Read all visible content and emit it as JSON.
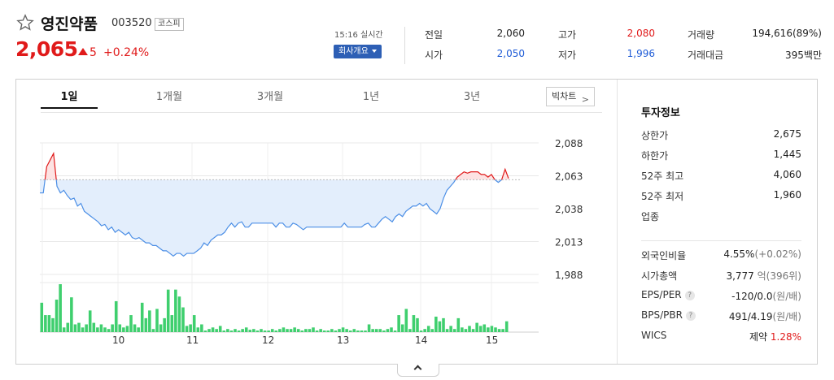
{
  "header": {
    "stock_name": "영진약품",
    "stock_code": "003520",
    "market": "코스피",
    "price": "2,065",
    "change": "5",
    "change_pct": "+0.24%",
    "time": "15:16 실시간",
    "profile_button": "회사개요"
  },
  "quotes": {
    "prev_label": "전일",
    "prev_value": "2,060",
    "open_label": "시가",
    "open_value": "2,050",
    "high_label": "고가",
    "high_value": "2,080",
    "low_label": "저가",
    "low_value": "1,996",
    "volume_label": "거래량",
    "volume_value": "194,616(89%)",
    "amount_label": "거래대금",
    "amount_value": "395백만"
  },
  "tabs": [
    {
      "label": "1일",
      "active": true
    },
    {
      "label": "1개월",
      "active": false
    },
    {
      "label": "3개월",
      "active": false
    },
    {
      "label": "1년",
      "active": false
    },
    {
      "label": "3년",
      "active": false
    }
  ],
  "bigchart_button": "빅차트",
  "info": {
    "title": "투자정보",
    "upper_limit_label": "상한가",
    "upper_limit_value": "2,675",
    "lower_limit_label": "하한가",
    "lower_limit_value": "1,445",
    "high52_label": "52주 최고",
    "high52_value": "4,060",
    "low52_label": "52주 최저",
    "low52_value": "1,960",
    "industry_label": "업종",
    "foreign_label": "외국인비율",
    "foreign_value": "4.55%",
    "foreign_change": "(+0.02%)",
    "mcap_label": "시가총액",
    "mcap_value": "3,777",
    "mcap_unit": "억(396위)",
    "eps_label": "EPS/PER",
    "eps_value": "-120/0.0",
    "eps_unit": "(원/배)",
    "bps_label": "BPS/PBR",
    "bps_value": "491/4.19",
    "bps_unit": "(원/배)",
    "wics_label": "WICS",
    "wics_value": "제약",
    "wics_pct": "1.28%"
  },
  "colors": {
    "up": "#e01a1a",
    "down": "#1e5bd6",
    "line_down": "#4c8fe6",
    "volume": "#3fcf6e"
  },
  "chart_data": {
    "type": "line",
    "yticks": [
      "2,088",
      "2,063",
      "2,038",
      "2,013",
      "1,988"
    ],
    "ylim": [
      1988,
      2088
    ],
    "xticks": [
      "10",
      "11",
      "12",
      "13",
      "14",
      "15"
    ],
    "prev_close": 2060,
    "price": [
      2050,
      2050,
      2070,
      2075,
      2080,
      2055,
      2050,
      2052,
      2048,
      2045,
      2046,
      2040,
      2042,
      2036,
      2034,
      2032,
      2030,
      2028,
      2025,
      2026,
      2022,
      2024,
      2020,
      2022,
      2020,
      2018,
      2020,
      2016,
      2015,
      2016,
      2014,
      2012,
      2012,
      2010,
      2010,
      2008,
      2006,
      2006,
      2004,
      2002,
      2004,
      2004,
      2002,
      2004,
      2004,
      2004,
      2006,
      2008,
      2012,
      2010,
      2014,
      2016,
      2018,
      2018,
      2020,
      2024,
      2027,
      2024,
      2027,
      2028,
      2024,
      2024,
      2027,
      2027,
      2027,
      2027,
      2027,
      2027,
      2027,
      2024,
      2027,
      2027,
      2024,
      2024,
      2027,
      2026,
      2024,
      2022,
      2024,
      2024,
      2024,
      2024,
      2024,
      2024,
      2024,
      2024,
      2024,
      2024,
      2024,
      2027,
      2024,
      2024,
      2024,
      2024,
      2024,
      2026,
      2027,
      2024,
      2024,
      2027,
      2030,
      2032,
      2030,
      2028,
      2032,
      2034,
      2032,
      2036,
      2038,
      2040,
      2040,
      2042,
      2040,
      2042,
      2038,
      2036,
      2034,
      2038,
      2046,
      2052,
      2055,
      2058,
      2062,
      2064,
      2066,
      2065,
      2066,
      2066,
      2066,
      2064,
      2064,
      2062,
      2064,
      2060,
      2058,
      2060,
      2068,
      2061
    ],
    "volume": [
      38,
      22,
      22,
      18,
      42,
      62,
      6,
      12,
      45,
      10,
      12,
      6,
      10,
      28,
      12,
      6,
      10,
      6,
      4,
      10,
      40,
      10,
      6,
      8,
      22,
      10,
      6,
      38,
      18,
      28,
      4,
      30,
      10,
      18,
      55,
      22,
      55,
      46,
      32,
      8,
      10,
      22,
      6,
      10,
      2,
      4,
      6,
      4,
      8,
      2,
      4,
      2,
      4,
      2,
      4,
      6,
      3,
      4,
      2,
      4,
      2,
      2,
      4,
      2,
      4,
      6,
      4,
      4,
      6,
      4,
      2,
      4,
      4,
      6,
      2,
      4,
      2,
      2,
      4,
      2,
      4,
      6,
      4,
      2,
      4,
      2,
      2,
      2,
      10,
      4,
      4,
      4,
      2,
      4,
      6,
      2,
      22,
      10,
      30,
      4,
      22,
      18,
      2,
      4,
      8,
      4,
      20,
      14,
      18,
      4,
      8,
      4,
      18,
      6,
      4,
      8,
      4,
      12,
      8,
      10,
      6,
      8,
      6,
      4,
      4,
      14
    ]
  }
}
